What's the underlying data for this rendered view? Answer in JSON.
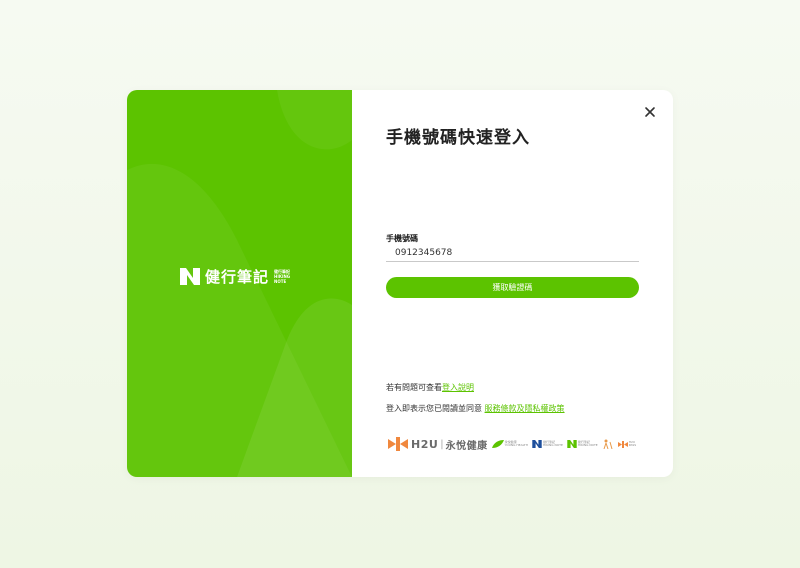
{
  "brand": {
    "name": "健行筆記",
    "sub_lines": [
      "健行筆記",
      "HIKING",
      "NOTE"
    ],
    "color": "#5cc300"
  },
  "login": {
    "title": "手機號碼快速登入",
    "phone_label": "手機號碼",
    "phone_value": "0912345678",
    "submit_label": "獲取驗證碼",
    "help_prefix": "若有問題可查看",
    "help_link": "登入說明",
    "terms_prefix": "登入即表示您已閱讀並同意",
    "terms_link": "服務條款及隱私權政策",
    "close_icon": "close-icon"
  },
  "partners": {
    "h2u": "H2U",
    "separator": "|",
    "yongyue": "永悅健康",
    "yk_lines": [
      "永悅健康",
      "YOUNG HEALTH"
    ],
    "hk_lines": [
      "健行筆記",
      "HIKING NOTE"
    ],
    "hn_lines": [
      "健行筆記",
      "HIKING NOTE"
    ],
    "h2u_small": "H2U",
    "h2u_small_sub": "PASS"
  }
}
